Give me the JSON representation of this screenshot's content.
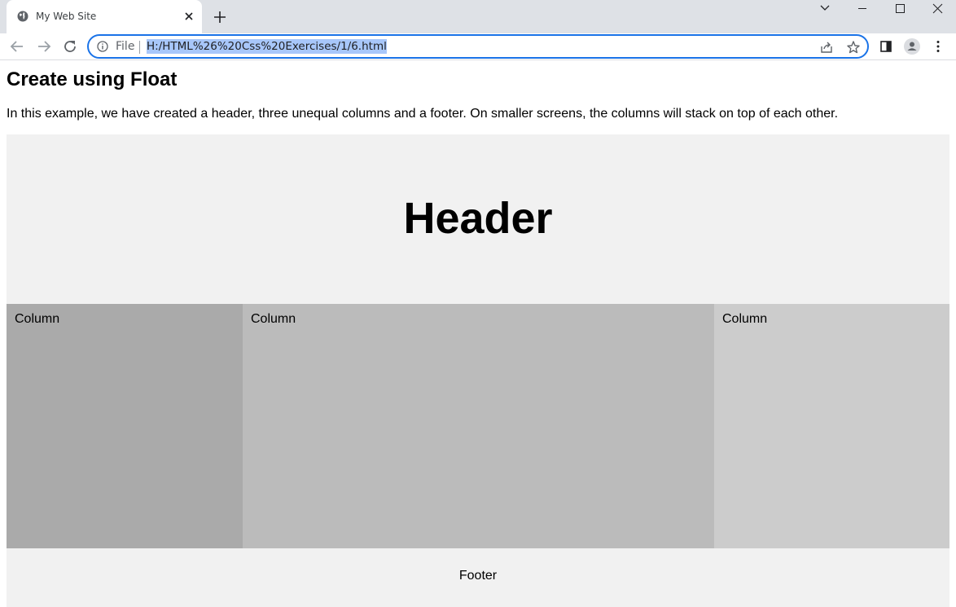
{
  "browser": {
    "tab": {
      "title": "My Web Site",
      "favicon": "globe-icon"
    },
    "address_bar": {
      "scheme_label": "File",
      "url": "H:/HTML%26%20Css%20Exercises/1/6.html"
    },
    "colors": {
      "accent": "#1a73e8",
      "url_selection": "#a8c7fa",
      "tabstrip": "#dee1e6"
    }
  },
  "page": {
    "title": "Create using Float",
    "intro": "In this example, we have created a header, three unequal columns and a footer. On smaller screens, the columns will stack on top of each other.",
    "header": "Header",
    "columns": [
      {
        "label": "Column",
        "color": "#aaaaaa"
      },
      {
        "label": "Column",
        "color": "#bbbbbb"
      },
      {
        "label": "Column",
        "color": "#cccccc"
      }
    ],
    "footer": "Footer"
  }
}
